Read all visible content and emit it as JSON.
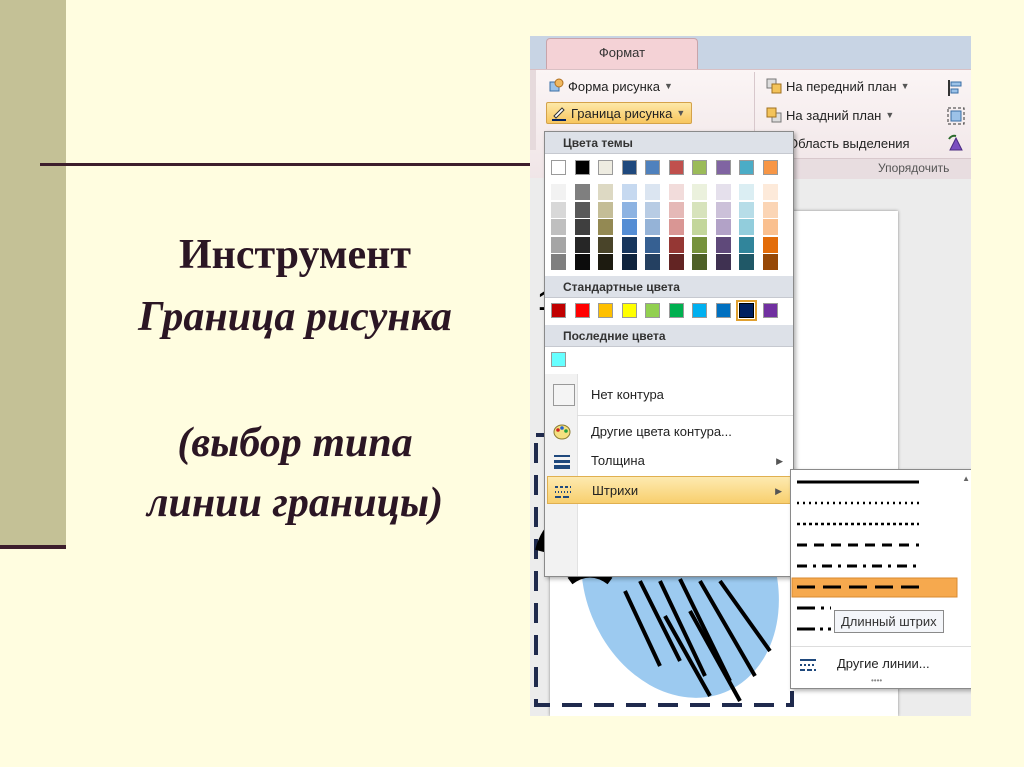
{
  "slide": {
    "title_line1": "Инструмент",
    "title_line2": "Граница рисунка",
    "title_line3": "(выбор типа",
    "title_line4": "линии границы)",
    "colors": {
      "background": "#fffde0",
      "sidebar": "#c4c196",
      "rule": "#3d1e2c",
      "title": "#2b1624"
    }
  },
  "ribbon": {
    "tab_label": "Формат",
    "shape_button": "Форма рисунка",
    "border_button": "Граница рисунка",
    "bring_forward": "На передний план",
    "send_backward": "На задний план",
    "selection_pane": "Область выделения",
    "arrange_group": "Упорядочить"
  },
  "dropdown": {
    "theme_header": "Цвета темы",
    "standard_header": "Стандартные цвета",
    "recent_header": "Последние цвета",
    "no_outline": "Нет контура",
    "more_colors": "Другие цвета контура...",
    "weight": "Толщина",
    "dashes": "Штрихи",
    "theme_top": [
      "#ffffff",
      "#000000",
      "#eeece1",
      "#1f497d",
      "#4f81bd",
      "#c0504d",
      "#9bbb59",
      "#8064a2",
      "#4bacc6",
      "#f79646"
    ],
    "theme_shades": [
      [
        "#f2f2f2",
        "#d8d8d8",
        "#bfbfbf",
        "#a5a5a5",
        "#7f7f7f"
      ],
      [
        "#7f7f7f",
        "#595959",
        "#3f3f3f",
        "#262626",
        "#0c0c0c"
      ],
      [
        "#ddd9c3",
        "#c4bd97",
        "#938953",
        "#494429",
        "#1d1b10"
      ],
      [
        "#c6d9f0",
        "#8db3e2",
        "#548dd4",
        "#17365d",
        "#0f243e"
      ],
      [
        "#dbe5f1",
        "#b8cce4",
        "#95b3d7",
        "#366092",
        "#244061"
      ],
      [
        "#f2dcdb",
        "#e5b9b7",
        "#d99694",
        "#953734",
        "#632423"
      ],
      [
        "#ebf1dd",
        "#d7e3bc",
        "#c3d69b",
        "#76923c",
        "#4f6128"
      ],
      [
        "#e5e0ec",
        "#ccc1d9",
        "#b2a2c7",
        "#5f497a",
        "#3f3151"
      ],
      [
        "#dbeef3",
        "#b7dde8",
        "#92cddc",
        "#31859b",
        "#205867"
      ],
      [
        "#fdeada",
        "#fbd5b5",
        "#fac08f",
        "#e36c09",
        "#974806"
      ]
    ],
    "standard": [
      "#c00000",
      "#ff0000",
      "#ffc000",
      "#ffff00",
      "#92d050",
      "#00b050",
      "#00b0f0",
      "#0070c0",
      "#002060",
      "#7030a0"
    ],
    "recent": [
      "#66ffff"
    ]
  },
  "dash_submenu": {
    "styles": [
      "solid",
      "round-dot",
      "square-dot",
      "dash",
      "dash-dot",
      "long-dash",
      "long-dash-dot",
      "long-dash-dot-dot"
    ],
    "selected_index": 5,
    "tooltip": "Длинный штрих",
    "more_lines": "Другие линии..."
  },
  "doc": {
    "partial_text": "1"
  }
}
